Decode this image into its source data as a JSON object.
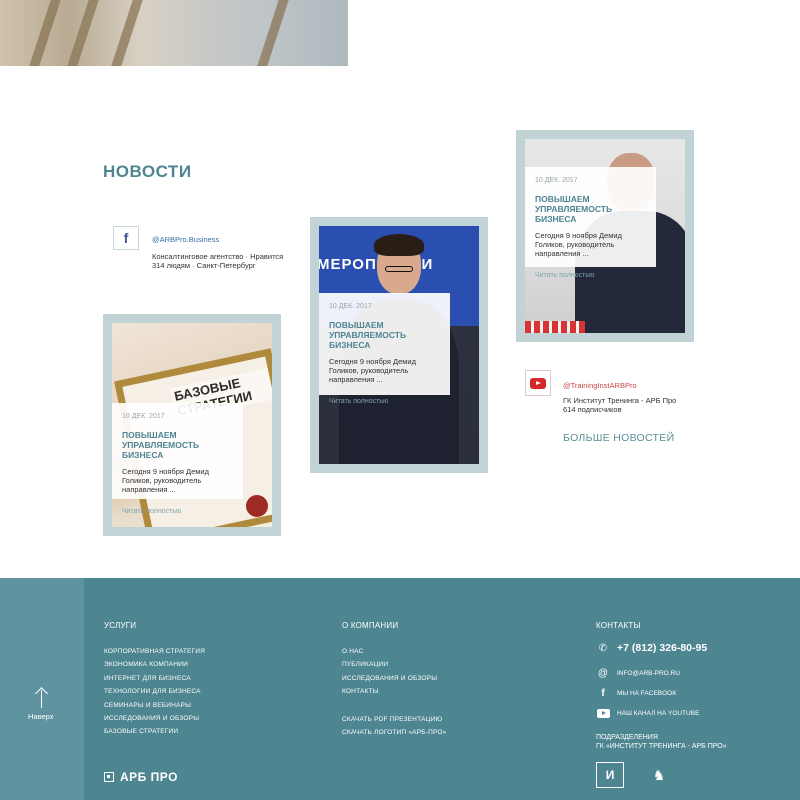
{
  "news": {
    "section_title": "НОВОСТИ",
    "more_link": "БОЛЬШЕ НОВОСТЕЙ",
    "cards": [
      {
        "date": "10 ДЕК. 2017",
        "title": "ПОВЫШАЕМ УПРАВЛЯЕМОСТЬ БИЗНЕСА",
        "excerpt": "Сегодня 9 ноября Демид Голиков, руководитель направления ...",
        "more": "Читать полностью",
        "photo_caption": "БАЗОВЫЕ СТРАТЕГИИ"
      },
      {
        "date": "10 ДЕК. 2017",
        "title": "ПОВЫШАЕМ УПРАВЛЯЕМОСТЬ БИЗНЕСА",
        "excerpt": "Сегодня 9 ноября Демид Голиков, руководитель направления ...",
        "more": "Читать полностью",
        "photo_caption": "МЕРОПРИЯТИ"
      },
      {
        "date": "10 ДЕК. 2017",
        "title": "ПОВЫШАЕМ УПРАВЛЯЕМОСТЬ БИЗНЕСА",
        "excerpt": "Сегодня 9 ноября Демид Голиков, руководитель направления ...",
        "more": "Читать полностью"
      }
    ]
  },
  "social": {
    "facebook": {
      "icon": "facebook-icon",
      "handle": "@ARBPro.Business",
      "desc_line1": "Консалтинговое агентство · Нравится",
      "desc_line2": "314 людям · Санкт-Петербург"
    },
    "youtube": {
      "icon": "youtube-icon",
      "handle": "@TrainingInstARBPro",
      "desc_line1": "ГК Институт Тренинга - АРБ Про",
      "desc_line2": "614 подписчиков"
    }
  },
  "footer": {
    "back_to_top": "Наверх",
    "services": {
      "heading": "УСЛУГИ",
      "items": [
        "Корпоративная стратегия",
        "Экономика компании",
        "Интернет для бизнеса",
        "Технологии для бизнеса",
        "Семинары и вебинары",
        "Исследования и обзоры",
        "Базовые стратегии"
      ]
    },
    "company": {
      "heading": "О КОМПАНИИ",
      "items": [
        "О нас",
        "Публикации",
        "Исследования и обзоры",
        "Контакты"
      ],
      "downloads": [
        "Скачать PDF презентацию",
        "Скачать логотип «АРБ-ПРО»"
      ]
    },
    "contacts": {
      "heading": "КОНТАКТЫ",
      "phone": "+7 (812) 326-80-95",
      "email": "info@arb-pro.ru",
      "facebook": "Мы на Facebook",
      "youtube": "Наш канал на YouTube"
    },
    "divisions_line1": "ПОДРАЗДЕЛЕНИЯ",
    "divisions_line2": "ГК «ИНСТИТУТ ТРЕНИНГА - АРБ ПРО»",
    "brand": "АРБ ПРО",
    "colors": {
      "footer_bg": "#4d8590",
      "footer_left": "#5f93a0",
      "accent": "#4e8592"
    }
  }
}
